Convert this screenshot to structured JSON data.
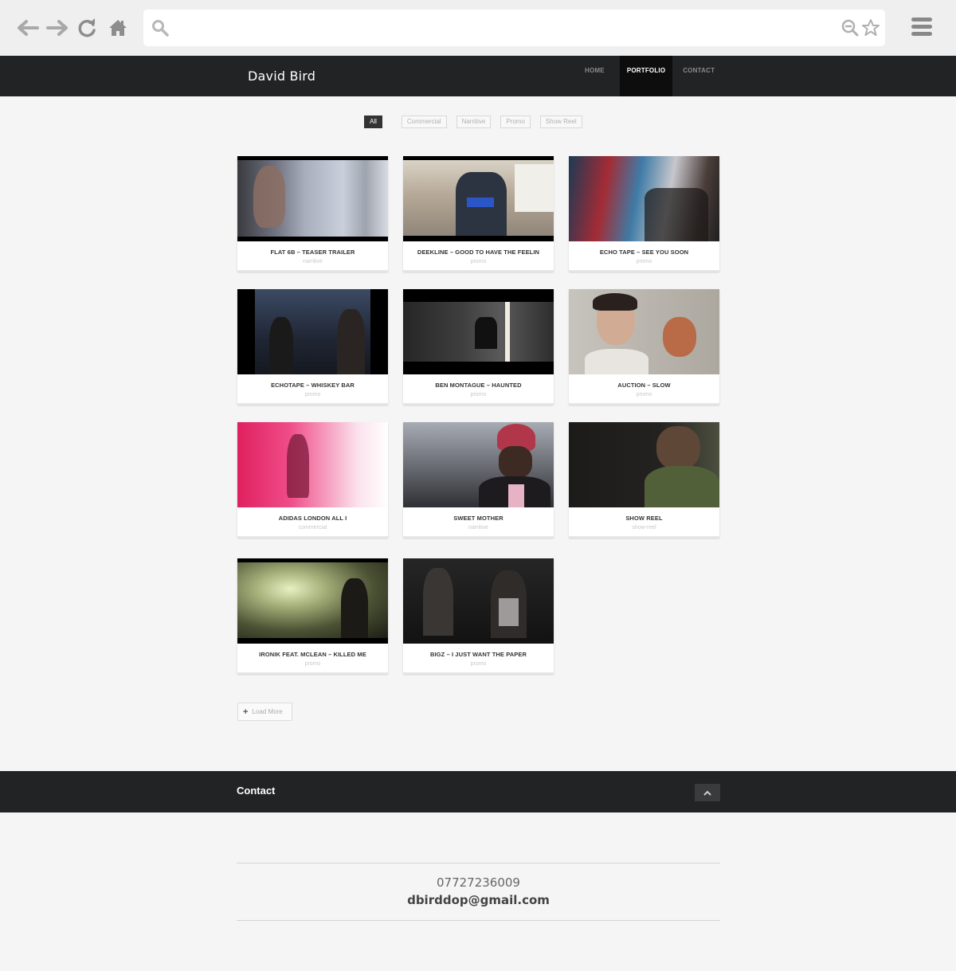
{
  "browser": {
    "icons": [
      "back-arrow-icon",
      "forward-arrow-icon",
      "reload-icon",
      "home-icon",
      "search-icon",
      "zoom-out-icon",
      "star-icon",
      "menu-icon"
    ],
    "address_value": ""
  },
  "site": {
    "brand": "David Bird",
    "nav": [
      {
        "label": "HOME",
        "active": false
      },
      {
        "label": "PORTFOLIO",
        "active": true
      },
      {
        "label": "CONTACT",
        "active": false
      }
    ]
  },
  "filters": [
    {
      "label": "All",
      "active": true
    },
    {
      "label": "Commercial",
      "active": false
    },
    {
      "label": "Narritive",
      "active": false
    },
    {
      "label": "Promo",
      "active": false
    },
    {
      "label": "Show Reel",
      "active": false
    }
  ],
  "portfolio": [
    {
      "title": "FLAT 6B – TEASER TRAILER",
      "category": "narritive"
    },
    {
      "title": "DEEKLINE – GOOD TO HAVE THE FEELIN",
      "category": "promo"
    },
    {
      "title": "ECHO TAPE – SEE YOU SOON",
      "category": "promo"
    },
    {
      "title": "ECHOTAPE – WHISKEY BAR",
      "category": "promo"
    },
    {
      "title": "BEN MONTAGUE – HAUNTED",
      "category": "promo"
    },
    {
      "title": "AUCTION – SLOW",
      "category": "promo"
    },
    {
      "title": "ADIDAS LONDON ALL I",
      "category": "commercial"
    },
    {
      "title": "SWEET MOTHER",
      "category": "narritive"
    },
    {
      "title": "SHOW REEL",
      "category": "show-reel"
    },
    {
      "title": "IRONIK FEAT. MCLEAN – KILLED ME",
      "category": "promo"
    },
    {
      "title": "BIGZ – I JUST WANT THE PAPER",
      "category": "promo"
    }
  ],
  "load_more": "Load More",
  "contact": {
    "heading": "Contact",
    "phone": "07727236009",
    "email": "dbirddop@gmail.com"
  },
  "colors": {
    "header_bg": "#222325",
    "active_nav_bg": "#0d0d0e",
    "page_bg": "#f5f5f5"
  }
}
